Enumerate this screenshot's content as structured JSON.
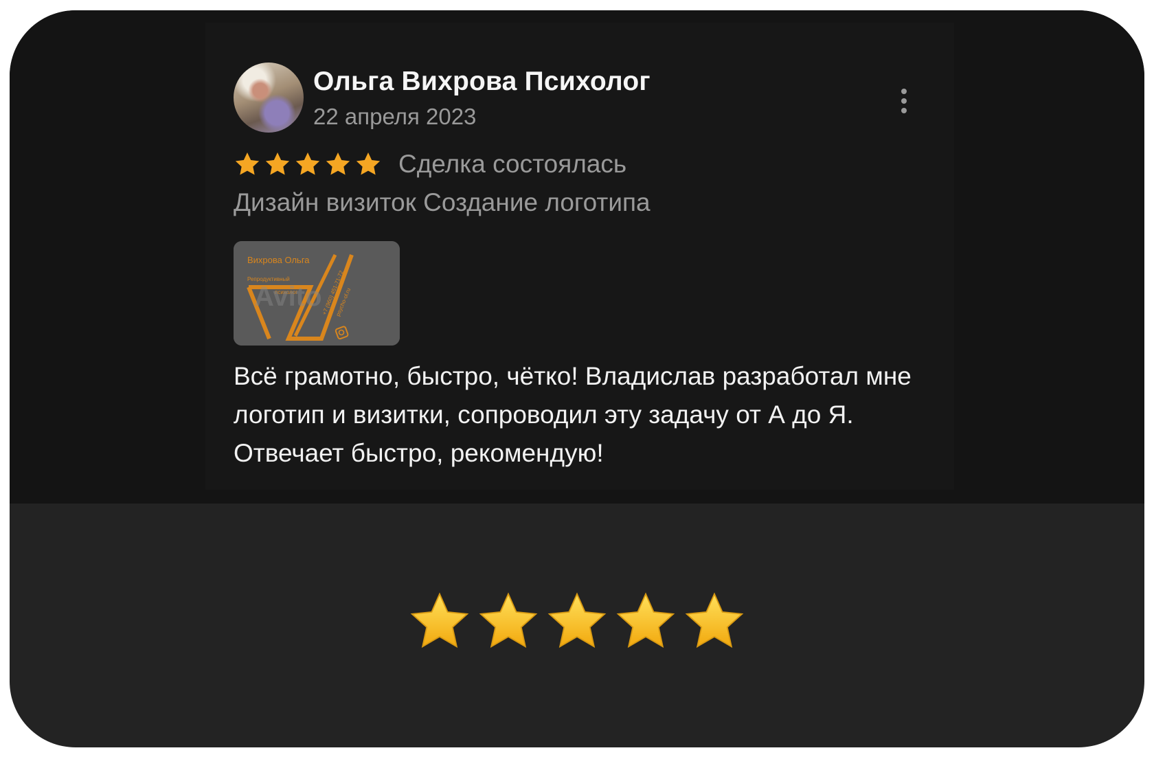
{
  "review": {
    "author": "Ольга Вихрова Психолог",
    "date": "22 апреля 2023",
    "rating": 5,
    "rating_max": 5,
    "deal_status": "Сделка состоялась",
    "services": "Дизайн визиток Создание логотипа",
    "text": "Всё грамотно, быстро, чётко! Владислав разработал мне логотип и визитки, сопроводил эту задачу от А до Я. Отвечает быстро, рекомендую!",
    "thumbnail": {
      "name": "Вихрова Ольга",
      "subtitle_1": "Репродуктивный",
      "subtitle_2": "психолог",
      "phone": "+7 (960) 451-71-72",
      "site": "psycho-ol.ru",
      "watermark": "Avito"
    }
  },
  "footer": {
    "rating": 5,
    "rating_max": 5
  },
  "colors": {
    "star_small": "#f5a623",
    "star_big": "#f7c325",
    "accent_orange": "#d9861d",
    "text_primary": "#f5f5f5",
    "text_secondary": "#9a9a9a"
  }
}
